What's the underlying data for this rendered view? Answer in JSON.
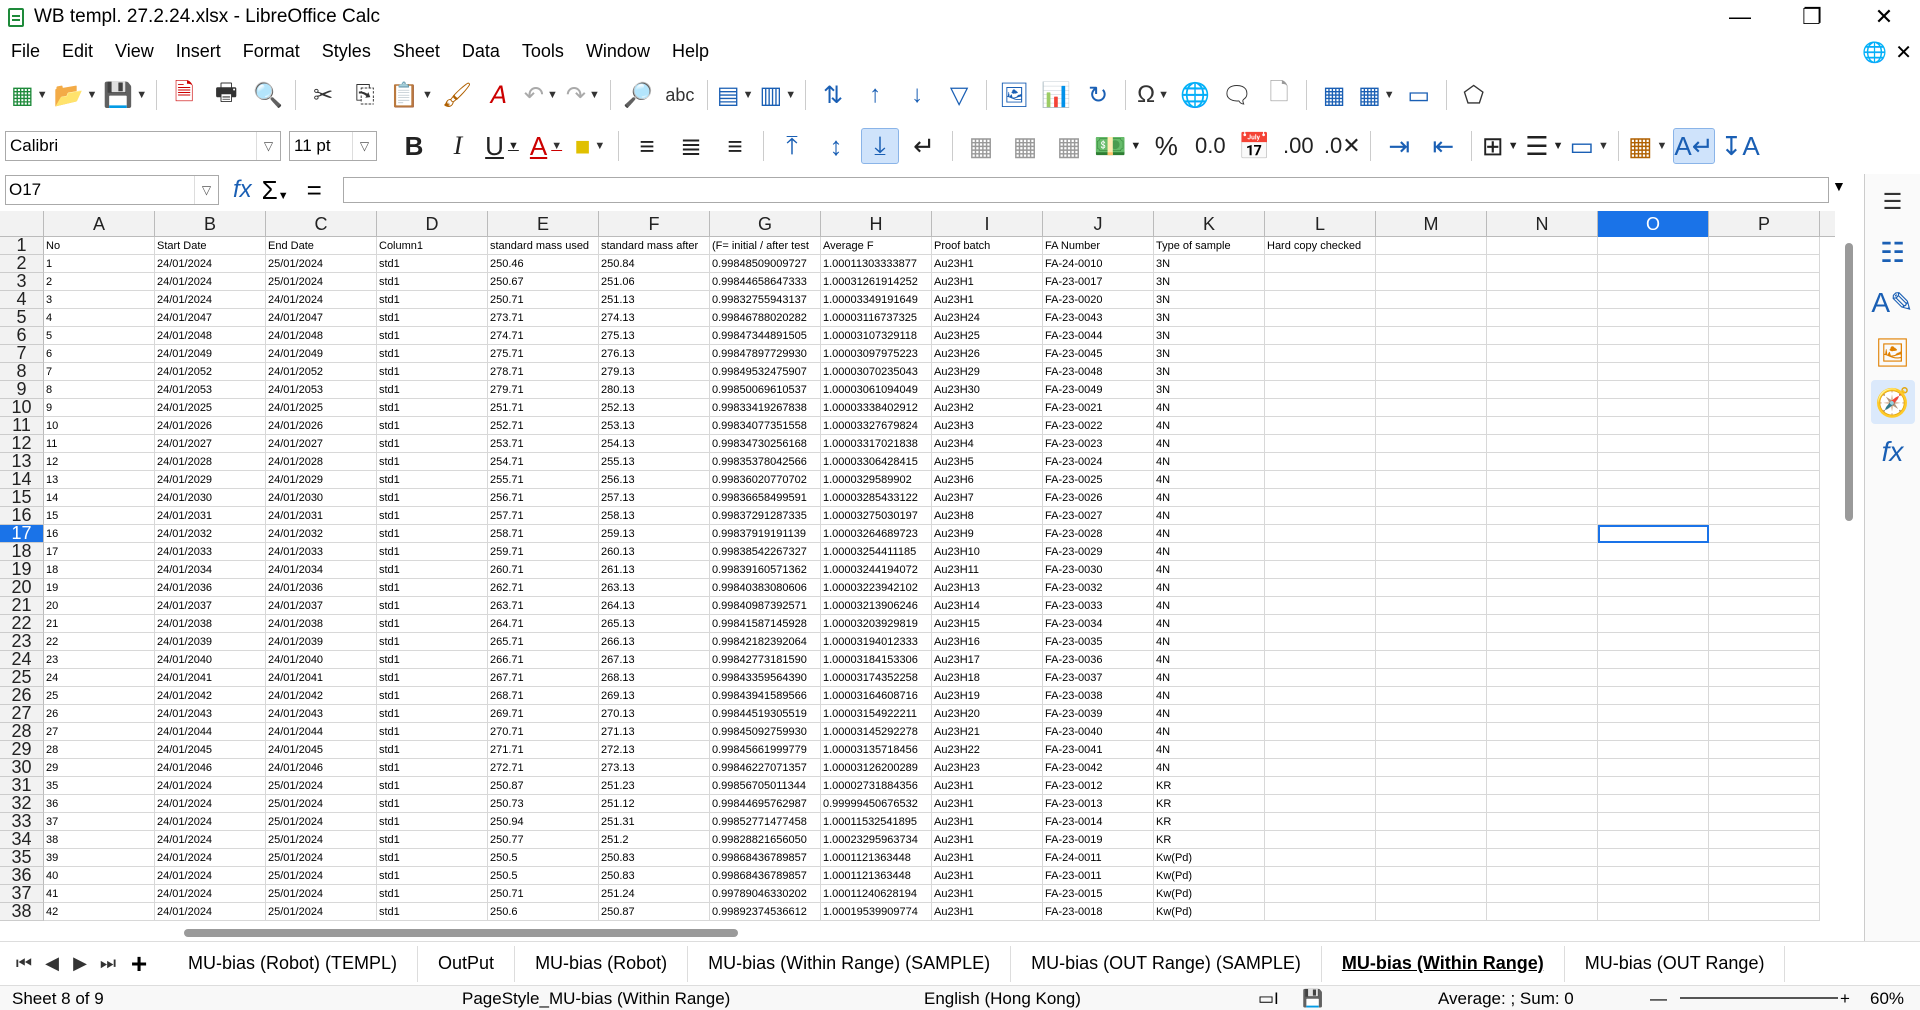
{
  "window": {
    "title": "WB templ. 27.2.24.xlsx - LibreOffice Calc"
  },
  "menu": [
    "File",
    "Edit",
    "View",
    "Insert",
    "Format",
    "Styles",
    "Sheet",
    "Data",
    "Tools",
    "Window",
    "Help"
  ],
  "format": {
    "font_name": "Calibri",
    "font_size": "11 pt"
  },
  "formula_bar": {
    "cell_ref": "O17",
    "content": ""
  },
  "columns": [
    "A",
    "B",
    "C",
    "D",
    "E",
    "F",
    "G",
    "H",
    "I",
    "J",
    "K",
    "L",
    "M",
    "N",
    "O",
    "P"
  ],
  "selected_column": "O",
  "selected_row": 17,
  "headers": [
    "No",
    "Start Date",
    "End Date",
    "Column1",
    "standard mass used",
    "standard mass after",
    "(F= initial / after test",
    "Average F",
    "Proof batch",
    "FA Number",
    "Type of sample",
    "Hard copy checked"
  ],
  "rows": [
    [
      "1",
      "24/01/2024",
      "25/01/2024",
      "std1",
      "250.46",
      "250.84",
      "0.99848509009727",
      "1.00011303333877",
      "Au23H1",
      "FA-24-0010",
      "3N"
    ],
    [
      "2",
      "24/01/2024",
      "25/01/2024",
      "std1",
      "250.67",
      "251.06",
      "0.99844658647333",
      "1.00031261914252",
      "Au23H1",
      "FA-23-0017",
      "3N"
    ],
    [
      "3",
      "24/01/2024",
      "24/01/2024",
      "std1",
      "250.71",
      "251.13",
      "0.99832755943137",
      "1.00003349191649",
      "Au23H1",
      "FA-23-0020",
      "3N"
    ],
    [
      "4",
      "24/01/2047",
      "24/01/2047",
      "std1",
      "273.71",
      "274.13",
      "0.99846788020282",
      "1.00003116737325",
      "Au23H24",
      "FA-23-0043",
      "3N"
    ],
    [
      "5",
      "24/01/2048",
      "24/01/2048",
      "std1",
      "274.71",
      "275.13",
      "0.99847344891505",
      "1.00003107329118",
      "Au23H25",
      "FA-23-0044",
      "3N"
    ],
    [
      "6",
      "24/01/2049",
      "24/01/2049",
      "std1",
      "275.71",
      "276.13",
      "0.99847897729930",
      "1.00003097975223",
      "Au23H26",
      "FA-23-0045",
      "3N"
    ],
    [
      "7",
      "24/01/2052",
      "24/01/2052",
      "std1",
      "278.71",
      "279.13",
      "0.99849532475907",
      "1.00003070235043",
      "Au23H29",
      "FA-23-0048",
      "3N"
    ],
    [
      "8",
      "24/01/2053",
      "24/01/2053",
      "std1",
      "279.71",
      "280.13",
      "0.99850069610537",
      "1.00003061094049",
      "Au23H30",
      "FA-23-0049",
      "3N"
    ],
    [
      "9",
      "24/01/2025",
      "24/01/2025",
      "std1",
      "251.71",
      "252.13",
      "0.99833419267838",
      "1.00003338402912",
      "Au23H2",
      "FA-23-0021",
      "4N"
    ],
    [
      "10",
      "24/01/2026",
      "24/01/2026",
      "std1",
      "252.71",
      "253.13",
      "0.99834077351558",
      "1.00003327679824",
      "Au23H3",
      "FA-23-0022",
      "4N"
    ],
    [
      "11",
      "24/01/2027",
      "24/01/2027",
      "std1",
      "253.71",
      "254.13",
      "0.99834730256168",
      "1.00003317021838",
      "Au23H4",
      "FA-23-0023",
      "4N"
    ],
    [
      "12",
      "24/01/2028",
      "24/01/2028",
      "std1",
      "254.71",
      "255.13",
      "0.99835378042566",
      "1.00003306428415",
      "Au23H5",
      "FA-23-0024",
      "4N"
    ],
    [
      "13",
      "24/01/2029",
      "24/01/2029",
      "std1",
      "255.71",
      "256.13",
      "0.99836020770702",
      "1.0000329589902",
      "Au23H6",
      "FA-23-0025",
      "4N"
    ],
    [
      "14",
      "24/01/2030",
      "24/01/2030",
      "std1",
      "256.71",
      "257.13",
      "0.99836658499591",
      "1.00003285433122",
      "Au23H7",
      "FA-23-0026",
      "4N"
    ],
    [
      "15",
      "24/01/2031",
      "24/01/2031",
      "std1",
      "257.71",
      "258.13",
      "0.99837291287335",
      "1.00003275030197",
      "Au23H8",
      "FA-23-0027",
      "4N"
    ],
    [
      "16",
      "24/01/2032",
      "24/01/2032",
      "std1",
      "258.71",
      "259.13",
      "0.99837919191139",
      "1.00003264689723",
      "Au23H9",
      "FA-23-0028",
      "4N"
    ],
    [
      "17",
      "24/01/2033",
      "24/01/2033",
      "std1",
      "259.71",
      "260.13",
      "0.99838542267327",
      "1.00003254411185",
      "Au23H10",
      "FA-23-0029",
      "4N"
    ],
    [
      "18",
      "24/01/2034",
      "24/01/2034",
      "std1",
      "260.71",
      "261.13",
      "0.99839160571362",
      "1.00003244194072",
      "Au23H11",
      "FA-23-0030",
      "4N"
    ],
    [
      "19",
      "24/01/2036",
      "24/01/2036",
      "std1",
      "262.71",
      "263.13",
      "0.99840383080606",
      "1.00003223942102",
      "Au23H13",
      "FA-23-0032",
      "4N"
    ],
    [
      "20",
      "24/01/2037",
      "24/01/2037",
      "std1",
      "263.71",
      "264.13",
      "0.99840987392571",
      "1.00003213906246",
      "Au23H14",
      "FA-23-0033",
      "4N"
    ],
    [
      "21",
      "24/01/2038",
      "24/01/2038",
      "std1",
      "264.71",
      "265.13",
      "0.99841587145928",
      "1.00003203929819",
      "Au23H15",
      "FA-23-0034",
      "4N"
    ],
    [
      "22",
      "24/01/2039",
      "24/01/2039",
      "std1",
      "265.71",
      "266.13",
      "0.99842182392064",
      "1.00003194012333",
      "Au23H16",
      "FA-23-0035",
      "4N"
    ],
    [
      "23",
      "24/01/2040",
      "24/01/2040",
      "std1",
      "266.71",
      "267.13",
      "0.99842773181590",
      "1.00003184153306",
      "Au23H17",
      "FA-23-0036",
      "4N"
    ],
    [
      "24",
      "24/01/2041",
      "24/01/2041",
      "std1",
      "267.71",
      "268.13",
      "0.99843359564390",
      "1.00003174352258",
      "Au23H18",
      "FA-23-0037",
      "4N"
    ],
    [
      "25",
      "24/01/2042",
      "24/01/2042",
      "std1",
      "268.71",
      "269.13",
      "0.99843941589566",
      "1.00003164608716",
      "Au23H19",
      "FA-23-0038",
      "4N"
    ],
    [
      "26",
      "24/01/2043",
      "24/01/2043",
      "std1",
      "269.71",
      "270.13",
      "0.99844519305519",
      "1.00003154922211",
      "Au23H20",
      "FA-23-0039",
      "4N"
    ],
    [
      "27",
      "24/01/2044",
      "24/01/2044",
      "std1",
      "270.71",
      "271.13",
      "0.99845092759930",
      "1.00003145292278",
      "Au23H21",
      "FA-23-0040",
      "4N"
    ],
    [
      "28",
      "24/01/2045",
      "24/01/2045",
      "std1",
      "271.71",
      "272.13",
      "0.99845661999779",
      "1.00003135718456",
      "Au23H22",
      "FA-23-0041",
      "4N"
    ],
    [
      "29",
      "24/01/2046",
      "24/01/2046",
      "std1",
      "272.71",
      "273.13",
      "0.99846227071357",
      "1.00003126200289",
      "Au23H23",
      "FA-23-0042",
      "4N"
    ],
    [
      "35",
      "24/01/2024",
      "25/01/2024",
      "std1",
      "250.87",
      "251.23",
      "0.99856705011344",
      "1.00002731884356",
      "Au23H1",
      "FA-23-0012",
      "KR"
    ],
    [
      "36",
      "24/01/2024",
      "25/01/2024",
      "std1",
      "250.73",
      "251.12",
      "0.99844695762987",
      "0.99999450676532",
      "Au23H1",
      "FA-23-0013",
      "KR"
    ],
    [
      "37",
      "24/01/2024",
      "25/01/2024",
      "std1",
      "250.94",
      "251.31",
      "0.99852771477458",
      "1.00011532541895",
      "Au23H1",
      "FA-23-0014",
      "KR"
    ],
    [
      "38",
      "24/01/2024",
      "25/01/2024",
      "std1",
      "250.77",
      "251.2",
      "0.99828821656050",
      "1.00023295963734",
      "Au23H1",
      "FA-23-0019",
      "KR"
    ],
    [
      "39",
      "24/01/2024",
      "25/01/2024",
      "std1",
      "250.5",
      "250.83",
      "0.99868436789857",
      "1.0001121363448",
      "Au23H1",
      "FA-24-0011",
      "Kw(Pd)"
    ],
    [
      "40",
      "24/01/2024",
      "25/01/2024",
      "std1",
      "250.5",
      "250.83",
      "0.99868436789857",
      "1.0001121363448",
      "Au23H1",
      "FA-23-0011",
      "Kw(Pd)"
    ],
    [
      "41",
      "24/01/2024",
      "25/01/2024",
      "std1",
      "250.71",
      "251.24",
      "0.99789046330202",
      "1.00011240628194",
      "Au23H1",
      "FA-23-0015",
      "Kw(Pd)"
    ],
    [
      "42",
      "24/01/2024",
      "25/01/2024",
      "std1",
      "250.6",
      "250.87",
      "0.99892374536612",
      "1.00019539909774",
      "Au23H1",
      "FA-23-0018",
      "Kw(Pd)"
    ]
  ],
  "tabs": [
    "MU-bias (Robot) (TEMPL)",
    "OutPut",
    "MU-bias (Robot)",
    "MU-bias (Within Range) (SAMPLE)",
    "MU-bias (OUT Range) (SAMPLE)",
    "MU-bias (Within Range)",
    "MU-bias (OUT Range)"
  ],
  "active_tab": "MU-bias (Within Range)",
  "status": {
    "sheet": "Sheet 8 of 9",
    "page_style": "PageStyle_MU-bias (Within Range)",
    "language": "English (Hong Kong)",
    "summary": "Average: ; Sum: 0",
    "zoom": "60%"
  },
  "colors": {
    "accent": "#1a73e8",
    "header_bg": "#f2f2f2"
  }
}
